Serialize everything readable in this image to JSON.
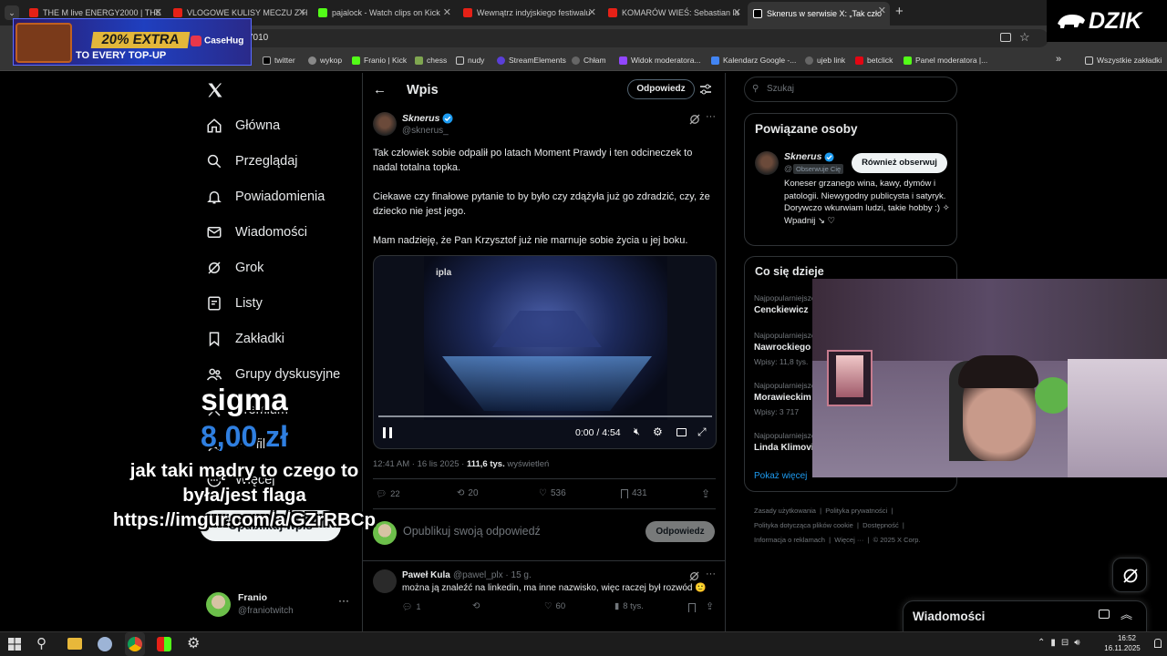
{
  "browser": {
    "tabs": [
      {
        "title": "THE M live ENERGY2000 | THE",
        "color": "#e62117"
      },
      {
        "title": "VLOGOWE KULISY MECZU Z H",
        "color": "#e62117"
      },
      {
        "title": "pajalock - Watch clips on Kick",
        "color": "#53fc18"
      },
      {
        "title": "Wewnątrz indyjskiego festiwalu",
        "color": "#e62117"
      },
      {
        "title": "KOMARÓW WIEŚ: Sebastian la",
        "color": "#e62117"
      },
      {
        "title": "Sknerus w serwisie X: „Tak czło",
        "color": "#ffffff"
      }
    ],
    "new_tab": "+",
    "url_fragment": "7010",
    "bookmarks": [
      "twitter",
      "wykop",
      "Franio | Kick",
      "chess",
      "nudy",
      "StreamElements",
      "Chłam",
      "Widok moderatora...",
      "Kalendarz Google -...",
      "ujeb link",
      "betclick",
      "Panel moderatora |..."
    ],
    "bookmarks_all": "Wszystkie zakładki"
  },
  "ad": {
    "extra": "20% EXTRA",
    "topup": "TO EVERY TOP-UP",
    "brand": "CaseHug"
  },
  "stream_logo": "DZIK",
  "nav": {
    "items": [
      "Główna",
      "Przeglądaj",
      "Powiadomienia",
      "Wiadomości",
      "Grok",
      "Listy",
      "Zakładki",
      "Grupy dyskusyjne",
      "Premium",
      "Profil",
      "Więcej"
    ],
    "post_button": "Opublikuj wpis",
    "account_name": "Franio",
    "account_handle": "@franiotwitch"
  },
  "header": {
    "title": "Wpis",
    "reply_button": "Odpowiedz"
  },
  "post": {
    "author": "Sknerus",
    "handle": "@sknerus_",
    "p1": "Tak człowiek sobie odpalił po latach Moment Prawdy i ten odcineczek to nadal totalna topka.",
    "p2": "Ciekawe czy finałowe pytanie to by było czy zdążyła już go zdradzić, czy, że dziecko nie jest jego.",
    "p3": "Mam nadzieję, że Pan Krzysztof już nie marnuje sobie życia u jej boku.",
    "video_time": "0:00 / 4:54",
    "video_logo": "ipla",
    "timestamp": "12:41 AM · 16 lis 2025 · ",
    "views_count": "111,6 tys.",
    "views_label": " wyświetleń",
    "replies": "22",
    "reposts": "20",
    "likes": "536",
    "bookmarks": "431"
  },
  "reply_box": {
    "placeholder": "Opublikuj swoją odpowiedź",
    "button": "Odpowiedz"
  },
  "reply": {
    "author": "Paweł Kula",
    "meta": "@pawel_plx · 15 g.",
    "text": "można ją znaleźć na linkedin, ma inne nazwisko, więc raczej był rozwód 🙂",
    "replies": "1",
    "likes": "60",
    "views": "8 tys."
  },
  "search": {
    "placeholder": "Szukaj"
  },
  "related": {
    "title": "Powiązane osoby",
    "name": "Sknerus",
    "handle": "@",
    "follows_you": "Obserwuje Cię",
    "follow_button": "Również obserwuj",
    "bio": "Koneser grzanego wina, kawy, dymów i patologii. Niewygodny publicysta i satyryk. Dorywczo wkurwiam ludzi, takie hobby :)                ✧ Wpadnij ↘ ♡"
  },
  "trends": {
    "title": "Co się dzieje",
    "items": [
      {
        "cat": "Najpopularniejsze",
        "name": "Cenckiewicz",
        "count": ""
      },
      {
        "cat": "Najpopularniejsze",
        "name": "Nawrockiego",
        "count": "Wpisy: 11,8 tys."
      },
      {
        "cat": "Najpopularniejsze",
        "name": "Morawieckim",
        "count": "Wpisy: 3 717"
      },
      {
        "cat": "Najpopularniejsze",
        "name": "Linda Klimovi",
        "count": ""
      }
    ],
    "more": "Pokaż więcej"
  },
  "footer_links": [
    "Zasady użytkowania",
    "Polityka prywatności",
    "Polityka dotycząca plików cookie",
    "Dostępność",
    "Informacja o reklamach",
    "Więcej ···",
    "© 2025 X Corp."
  ],
  "messages_dock": {
    "title": "Wiadomości"
  },
  "donation": {
    "name": "sigma",
    "amount": "8,00 zł",
    "message": "jak taki mądry to czego to była/jest flaga https://imgur.com/a/GZrRBCp"
  },
  "clock": {
    "time": "16:52",
    "date": "16.11.2025"
  },
  "colors": {
    "accent": "#1d9bf0",
    "verified": "#1d9bf0",
    "donation_amount": "#2f7fe0"
  }
}
